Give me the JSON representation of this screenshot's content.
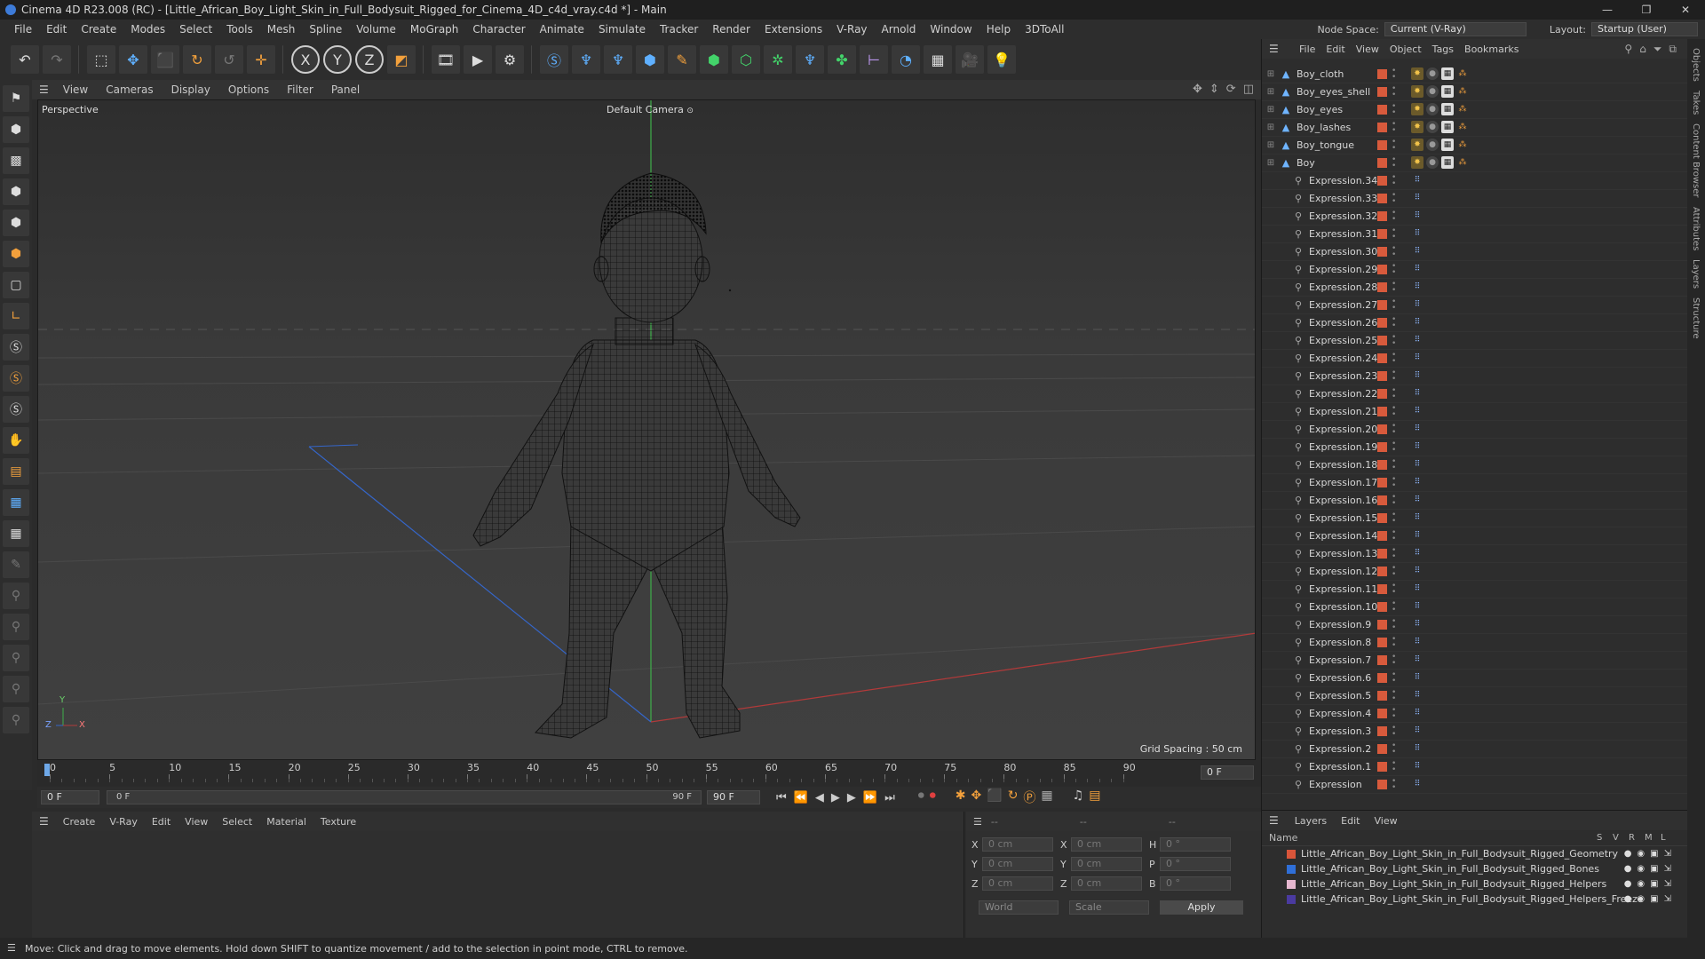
{
  "title": "Cinema 4D R23.008 (RC) - [Little_African_Boy_Light_Skin_in_Full_Bodysuit_Rigged_for_Cinema_4D_c4d_vray.c4d *] - Main",
  "window_controls": [
    "—",
    "❐",
    "✕"
  ],
  "menu": [
    "File",
    "Edit",
    "Create",
    "Modes",
    "Select",
    "Tools",
    "Mesh",
    "Spline",
    "Volume",
    "MoGraph",
    "Character",
    "Animate",
    "Simulate",
    "Tracker",
    "Render",
    "Extensions",
    "V-Ray",
    "Arnold",
    "Window",
    "Help",
    "3DToAll"
  ],
  "node_space": {
    "label": "Node Space:",
    "value": "Current (V-Ray)"
  },
  "layout": {
    "label": "Layout:",
    "value": "Startup (User)"
  },
  "viewport": {
    "menu": [
      "View",
      "Cameras",
      "Display",
      "Options",
      "Filter",
      "Panel"
    ],
    "label": "Perspective",
    "camera": "Default Camera",
    "grid_spacing": "Grid Spacing : 50 cm",
    "axis_labels": {
      "y": "Y",
      "z": "Z",
      "x": "X"
    }
  },
  "timeline": {
    "ticks": [
      "0",
      "5",
      "10",
      "15",
      "20",
      "25",
      "30",
      "35",
      "40",
      "45",
      "50",
      "55",
      "60",
      "65",
      "70",
      "75",
      "80",
      "85",
      "90"
    ],
    "current_frame": "0 F",
    "start": "0 F",
    "range_start": "0 F",
    "range_end": "90 F",
    "end": "90 F"
  },
  "material_menu": [
    "Create",
    "V-Ray",
    "Edit",
    "View",
    "Select",
    "Material",
    "Texture"
  ],
  "coords": {
    "header": [
      "--",
      "--",
      "--"
    ],
    "rows": [
      {
        "a": "X",
        "av": "0 cm",
        "b": "X",
        "bv": "0 cm",
        "c": "H",
        "cv": "0 °"
      },
      {
        "a": "Y",
        "av": "0 cm",
        "b": "Y",
        "bv": "0 cm",
        "c": "P",
        "cv": "0 °"
      },
      {
        "a": "Z",
        "av": "0 cm",
        "b": "Z",
        "bv": "0 cm",
        "c": "B",
        "cv": "0 °"
      }
    ],
    "world": "World",
    "scale": "Scale",
    "apply": "Apply"
  },
  "objects_menu": [
    "File",
    "Edit",
    "View",
    "Object",
    "Tags",
    "Bookmarks"
  ],
  "objects": [
    {
      "name": "Boy_cloth",
      "type": "mesh"
    },
    {
      "name": "Boy_eyes_shell",
      "type": "mesh"
    },
    {
      "name": "Boy_eyes",
      "type": "mesh"
    },
    {
      "name": "Boy_lashes",
      "type": "mesh"
    },
    {
      "name": "Boy_tongue",
      "type": "mesh"
    },
    {
      "name": "Boy",
      "type": "mesh"
    },
    {
      "name": "Expression.34",
      "type": "expr"
    },
    {
      "name": "Expression.33",
      "type": "expr"
    },
    {
      "name": "Expression.32",
      "type": "expr"
    },
    {
      "name": "Expression.31",
      "type": "expr"
    },
    {
      "name": "Expression.30",
      "type": "expr"
    },
    {
      "name": "Expression.29",
      "type": "expr"
    },
    {
      "name": "Expression.28",
      "type": "expr"
    },
    {
      "name": "Expression.27",
      "type": "expr"
    },
    {
      "name": "Expression.26",
      "type": "expr"
    },
    {
      "name": "Expression.25",
      "type": "expr"
    },
    {
      "name": "Expression.24",
      "type": "expr"
    },
    {
      "name": "Expression.23",
      "type": "expr"
    },
    {
      "name": "Expression.22",
      "type": "expr"
    },
    {
      "name": "Expression.21",
      "type": "expr"
    },
    {
      "name": "Expression.20",
      "type": "expr"
    },
    {
      "name": "Expression.19",
      "type": "expr"
    },
    {
      "name": "Expression.18",
      "type": "expr"
    },
    {
      "name": "Expression.17",
      "type": "expr"
    },
    {
      "name": "Expression.16",
      "type": "expr"
    },
    {
      "name": "Expression.15",
      "type": "expr"
    },
    {
      "name": "Expression.14",
      "type": "expr"
    },
    {
      "name": "Expression.13",
      "type": "expr"
    },
    {
      "name": "Expression.12",
      "type": "expr"
    },
    {
      "name": "Expression.11",
      "type": "expr"
    },
    {
      "name": "Expression.10",
      "type": "expr"
    },
    {
      "name": "Expression.9",
      "type": "expr"
    },
    {
      "name": "Expression.8",
      "type": "expr"
    },
    {
      "name": "Expression.7",
      "type": "expr"
    },
    {
      "name": "Expression.6",
      "type": "expr"
    },
    {
      "name": "Expression.5",
      "type": "expr"
    },
    {
      "name": "Expression.4",
      "type": "expr"
    },
    {
      "name": "Expression.3",
      "type": "expr"
    },
    {
      "name": "Expression.2",
      "type": "expr"
    },
    {
      "name": "Expression.1",
      "type": "expr"
    },
    {
      "name": "Expression",
      "type": "expr"
    }
  ],
  "layers_menu": [
    "Layers",
    "Edit",
    "View"
  ],
  "layers_header": {
    "name": "Name",
    "cols": [
      "S",
      "V",
      "R",
      "M",
      "L"
    ]
  },
  "layers": [
    {
      "name": "Little_African_Boy_Light_Skin_in_Full_Bodysuit_Rigged_Geometry",
      "color": "#d8553a"
    },
    {
      "name": "Little_African_Boy_Light_Skin_in_Full_Bodysuit_Rigged_Bones",
      "color": "#2f6fd8"
    },
    {
      "name": "Little_African_Boy_Light_Skin_in_Full_Bodysuit_Rigged_Helpers",
      "color": "#e6b8d0"
    },
    {
      "name": "Little_African_Boy_Light_Skin_in_Full_Bodysuit_Rigged_Helpers_Freeze",
      "color": "#4a3aa0"
    }
  ],
  "right_tabs": [
    "Objects",
    "Takes",
    "Content Browser",
    "Attributes",
    "Layers",
    "Structure"
  ],
  "status": "Move: Click and drag to move elements. Hold down SHIFT to quantize movement / add to the selection in point mode, CTRL to remove."
}
